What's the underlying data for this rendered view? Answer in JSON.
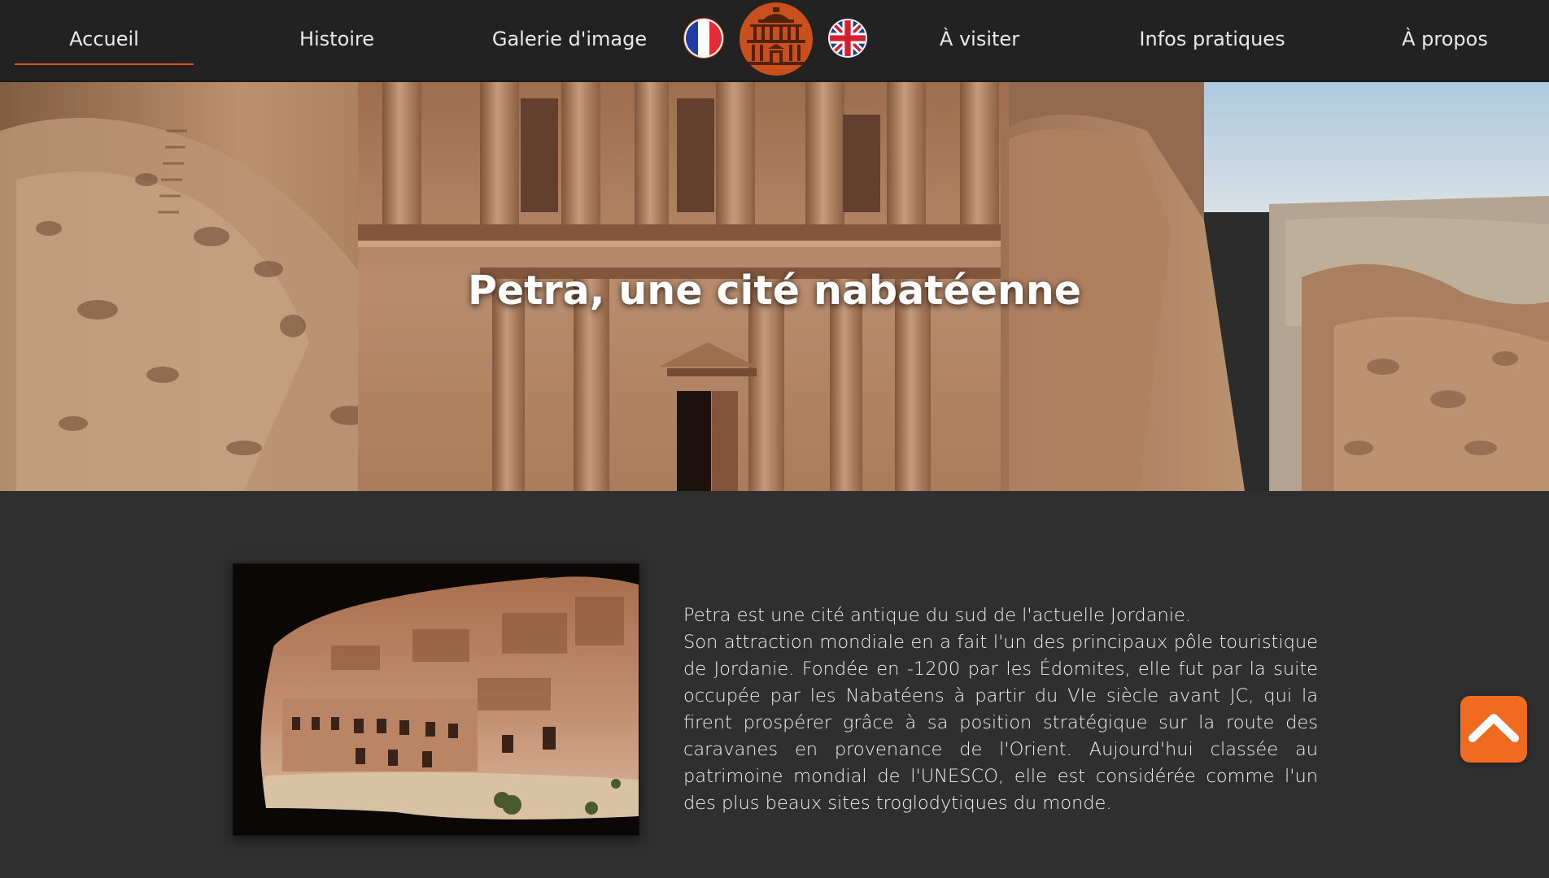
{
  "nav": {
    "items": [
      {
        "label": "Accueil",
        "active": true
      },
      {
        "label": "Histoire",
        "active": false
      },
      {
        "label": "Galerie d'image",
        "active": false
      },
      {
        "label": "À visiter",
        "active": false
      },
      {
        "label": "Infos pratiques",
        "active": false
      },
      {
        "label": "À propos",
        "active": false
      }
    ],
    "language_options": [
      "french-flag-icon",
      "uk-flag-icon"
    ],
    "logo_icon": "petra-monastery-logo-icon"
  },
  "hero": {
    "title": "Petra, une cité nabatéenne"
  },
  "intro": {
    "line1": "Petra est une cité antique du sud de l'actuelle Jordanie.",
    "paragraph": "Son attraction mondiale en a fait l'un des principaux pôle touristique de Jordanie. Fondée en -1200 par les Édomites, elle fut par la suite occupée par les Nabatéens à partir du VIe siècle avant JC, qui la firent prospérer grâce à sa position stratégique sur la route des caravanes en provenance de l'Orient. Aujourd'hui classée au patrimoine mondial de l'UNESCO, elle est considérée comme l'un des plus beaux sites troglodytiques du monde."
  },
  "colors": {
    "accent": "#d9541e",
    "scroll_button": "#f06a1f",
    "nav_background": "#222222",
    "page_background": "#2f2f2f"
  },
  "scroll_top_icon": "chevron-up-icon"
}
